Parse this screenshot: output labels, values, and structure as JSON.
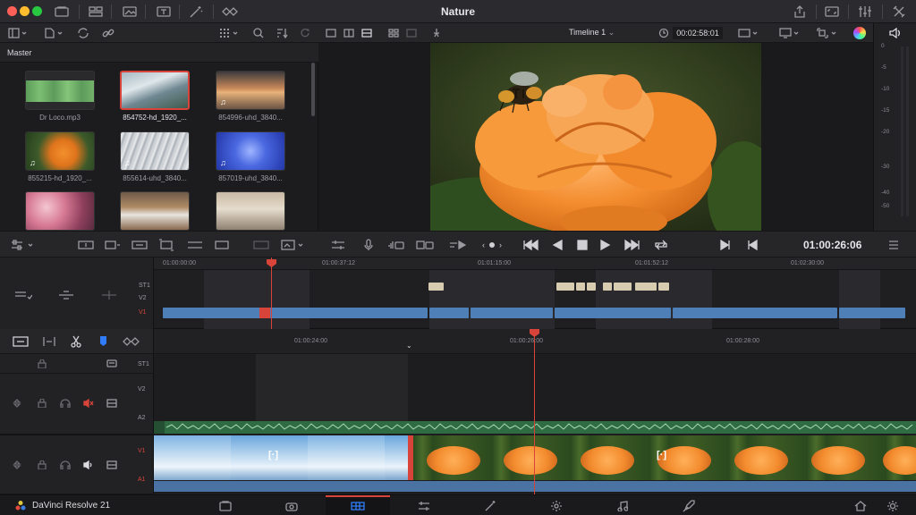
{
  "window": {
    "title": "Nature"
  },
  "media_pool": {
    "title": "Master",
    "clips": [
      {
        "name": "Dr Loco.mp3",
        "selected": false
      },
      {
        "name": "854752-hd_1920_...",
        "selected": true
      },
      {
        "name": "854996-uhd_3840...",
        "selected": false
      },
      {
        "name": "855215-hd_1920_...",
        "selected": false
      },
      {
        "name": "855614-uhd_3840...",
        "selected": false
      },
      {
        "name": "857019-uhd_3840...",
        "selected": false
      },
      {
        "name": "",
        "selected": false
      },
      {
        "name": "",
        "selected": false
      },
      {
        "name": "",
        "selected": false
      }
    ]
  },
  "viewer": {
    "timeline_name": "Timeline 1",
    "duration_tc": "00:02:58:01"
  },
  "meters": {
    "ticks": [
      "0",
      "-5",
      "-10",
      "-15",
      "-20",
      "-30",
      "-40",
      "-50"
    ]
  },
  "transport": {
    "timecode": "01:00:26:06"
  },
  "upper_timeline": {
    "ruler": [
      "01:00:00:00",
      "01:00:37:12",
      "01:01:15:00",
      "01:01:52:12",
      "01:02:30:00"
    ],
    "tracks": [
      "ST1",
      "V2",
      "V1"
    ]
  },
  "lower_timeline": {
    "ruler": [
      "01:00:24:00",
      "01:00:26:00",
      "01:00:28:00"
    ],
    "tracks": [
      "ST1",
      "V2",
      "A2",
      "V1",
      "A1"
    ]
  },
  "footer": {
    "brand": "DaVinci Resolve 21"
  },
  "colors": {
    "accent": "#d9443a",
    "clip_blue": "#4f7fb7",
    "audio_green": "#2f6b43"
  }
}
